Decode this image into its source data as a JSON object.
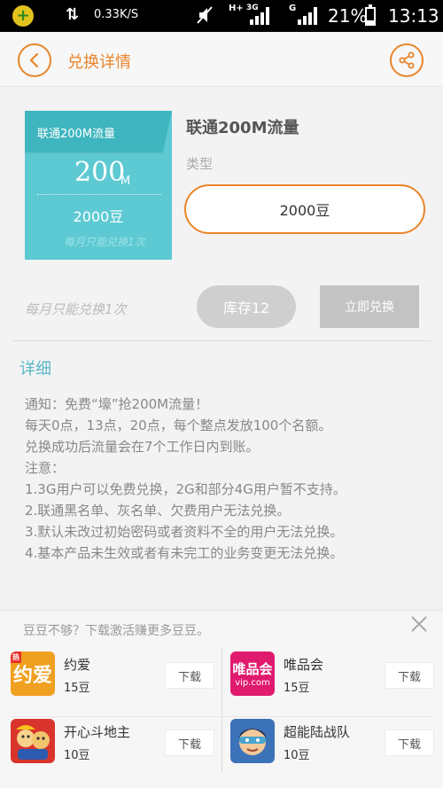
{
  "status_bar": {
    "speed": "0.33K/S",
    "network1": "H+",
    "network1b": "3G",
    "network2": "G",
    "battery": "21%",
    "battery_level": 0.21,
    "time": "13:13"
  },
  "header": {
    "title": "兑换详情",
    "back_icon": "chevron-left-icon",
    "share_icon": "share-icon"
  },
  "product": {
    "card_name": "联通200M流量",
    "card_big": "200",
    "card_unit": "M",
    "card_price": "2000豆",
    "card_limit": "每月只能兑换1次",
    "title": "联通200M流量",
    "type_label": "类型",
    "type_option": "2000豆"
  },
  "actions": {
    "limit_text": "每月只能兑换1次",
    "stock_label": "库存12",
    "exchange_label": "立即兑换"
  },
  "detail": {
    "title": "详细",
    "lines": [
      "通知：免费“壕”抢200M流量！",
      "每天0点，13点，20点，每个整点发放100个名额。",
      "兑换成功后流量会在7个工作日内到账。",
      "注意：",
      "1.3G用户可以免费兑换，2G和部分4G用户暂不支持。",
      "2.联通黑名单、灰名单、欠费用户无法兑换。",
      "3.默认未改过初始密码或者资料不全的用户无法兑换。",
      "4.基本产品未生效或者有未完工的业务变更无法兑换。"
    ]
  },
  "promo": {
    "title": "豆豆不够？下载激活赚更多豆豆。",
    "close_icon": "close-icon",
    "apps": [
      {
        "name": "约爱",
        "price": "15豆",
        "download": "下载",
        "icon_text": "约爱",
        "color": "#f0a020",
        "badge": "热"
      },
      {
        "name": "唯品会",
        "price": "15豆",
        "download": "下载",
        "icon_text": "唯品会",
        "icon_sub": "vip.com",
        "color": "#e01a6e"
      },
      {
        "name": "开心斗地主",
        "price": "10豆",
        "download": "下载",
        "color": "#d9342c"
      },
      {
        "name": "超能陆战队",
        "price": "10豆",
        "download": "下载",
        "color": "#3c72b8"
      }
    ]
  },
  "colors": {
    "accent": "#e8852a",
    "card": "#5dc9d2",
    "detail_title": "#59b7c7"
  }
}
